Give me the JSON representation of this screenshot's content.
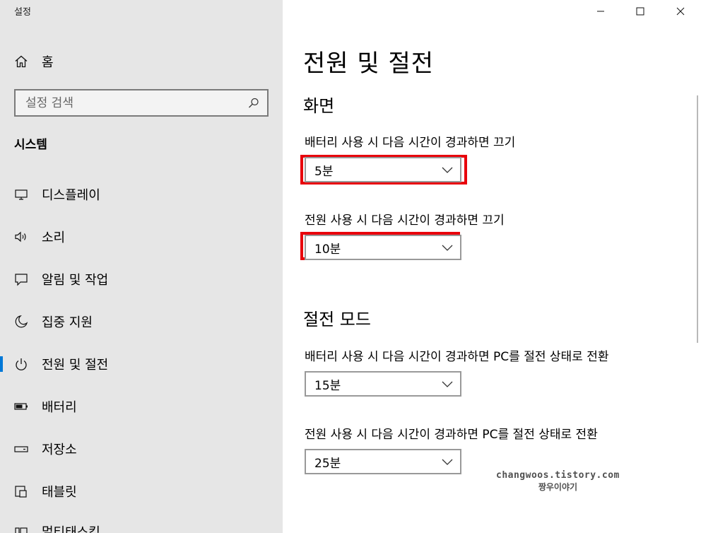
{
  "window": {
    "title": "설정"
  },
  "sidebar": {
    "home_label": "홈",
    "search_placeholder": "설정 검색",
    "section_title": "시스템",
    "items": [
      {
        "label": "디스플레이",
        "icon": "monitor-icon"
      },
      {
        "label": "소리",
        "icon": "speaker-icon"
      },
      {
        "label": "알림 및 작업",
        "icon": "notification-icon"
      },
      {
        "label": "집중 지원",
        "icon": "moon-icon"
      },
      {
        "label": "전원 및 절전",
        "icon": "power-icon",
        "selected": true
      },
      {
        "label": "배터리",
        "icon": "battery-icon"
      },
      {
        "label": "저장소",
        "icon": "storage-icon"
      },
      {
        "label": "태블릿",
        "icon": "tablet-icon"
      },
      {
        "label": "멀티태스킹",
        "icon": "multitasking-icon"
      }
    ]
  },
  "main": {
    "title": "전원 및 절전",
    "screen": {
      "heading": "화면",
      "battery_label": "배터리 사용 시 다음 시간이 경과하면 끄기",
      "battery_value": "5분",
      "power_label": "전원 사용 시 다음 시간이 경과하면 끄기",
      "power_value": "10분"
    },
    "sleep": {
      "heading": "절전 모드",
      "battery_label": "배터리 사용 시 다음 시간이 경과하면 PC를 절전 상태로 전환",
      "battery_value": "15분",
      "power_label": "전원 사용 시 다음 시간이 경과하면 PC를 절전 상태로 전환",
      "power_value": "25분"
    }
  },
  "watermark": {
    "line1": "changwoos.tistory.com",
    "line2": "짱우이야기"
  },
  "colors": {
    "sidebar_bg": "#e6e6e6",
    "accent": "#0078d7",
    "highlight": "#e8000b"
  }
}
